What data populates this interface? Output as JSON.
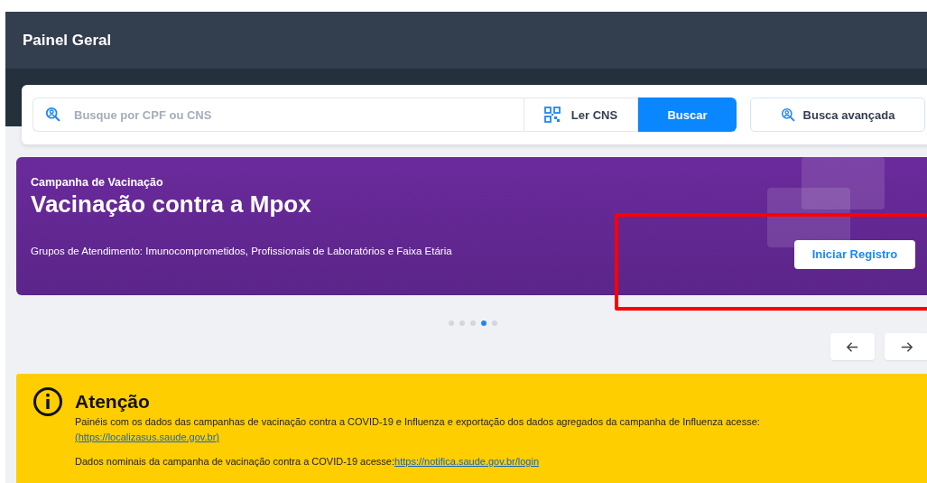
{
  "header": {
    "title": "Painel Geral"
  },
  "search": {
    "placeholder": "Busque por CPF ou CNS",
    "scan_button": "Ler CNS",
    "search_button": "Buscar",
    "advanced_button": "Busca avançada"
  },
  "banner": {
    "eyebrow": "Campanha de Vacinação",
    "title": "Vacinação contra a Mpox",
    "groups": "Grupos de Atendimento: Imunocomprometidos, Profissionais de Laboratórios e Faixa Etária",
    "button": "Iniciar Registro"
  },
  "carousel_dots": [
    {
      "selected": false
    },
    {
      "selected": false
    },
    {
      "selected": false
    },
    {
      "selected": true
    },
    {
      "selected": false
    }
  ],
  "carousel_nav": [
    {
      "kind": "prev"
    },
    {
      "kind": "next"
    }
  ],
  "notice": {
    "title": "Atenção",
    "paragraphs": [
      {
        "text": "Painéis com os dados das campanhas de vacinação contra a COVID-19 e Influenza e exportação dos dados agregados da campanha de Influenza acesse:",
        "link": "(https://localizasus.saude.gov.br)",
        "link_on_new_line": true
      },
      {
        "text": "Dados nominais da campanha de vacinação contra a COVID-19 acesse:",
        "link": "https://notifica.saude.gov.br/login",
        "link_on_new_line": false
      }
    ]
  },
  "annotations": [
    {
      "kind": "rectangle"
    }
  ]
}
